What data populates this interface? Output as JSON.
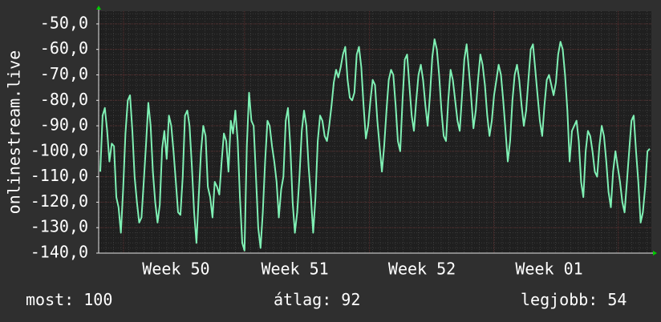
{
  "chart_data": {
    "type": "line",
    "ylabel": "onlinestream.live",
    "ylim": [
      -140,
      -45
    ],
    "y_ticks": [
      "-50,0",
      "-60,0",
      "-70,0",
      "-80,0",
      "-90,0",
      "-100,0",
      "-110,0",
      "-120,0",
      "-130,0",
      "-140,0"
    ],
    "y_tick_values": [
      -50,
      -60,
      -70,
      -80,
      -90,
      -100,
      -110,
      -120,
      -130,
      -140
    ],
    "x_ticks": [
      {
        "label": "Week 50",
        "at": 0.14
      },
      {
        "label": "Week 51",
        "at": 0.355
      },
      {
        "label": "Week 52",
        "at": 0.585
      },
      {
        "label": "Week 01",
        "at": 0.815
      }
    ],
    "grid": true,
    "series_color": "#7ff0b4",
    "series": [
      {
        "values": [
          -108,
          -86,
          -83,
          -92,
          -104,
          -97,
          -98,
          -118,
          -122,
          -132,
          -115,
          -93,
          -80,
          -78,
          -92,
          -110,
          -120,
          -128,
          -126,
          -112,
          -97,
          -81,
          -90,
          -108,
          -120,
          -128,
          -121,
          -99,
          -92,
          -103,
          -86,
          -90,
          -100,
          -112,
          -124,
          -125,
          -110,
          -86,
          -84,
          -90,
          -106,
          -124,
          -136,
          -118,
          -100,
          -90,
          -94,
          -114,
          -118,
          -126,
          -112,
          -114,
          -117,
          -104,
          -93,
          -96,
          -108,
          -88,
          -93,
          -84,
          -96,
          -118,
          -136,
          -139,
          -98,
          -77,
          -88,
          -90,
          -110,
          -130,
          -138,
          -124,
          -104,
          -88,
          -90,
          -98,
          -104,
          -112,
          -126,
          -115,
          -110,
          -88,
          -83,
          -98,
          -120,
          -132,
          -124,
          -110,
          -92,
          -84,
          -90,
          -106,
          -118,
          -132,
          -118,
          -96,
          -86,
          -88,
          -94,
          -96,
          -90,
          -82,
          -73,
          -68,
          -71,
          -67,
          -62,
          -59,
          -72,
          -79,
          -80,
          -77,
          -62,
          -59,
          -67,
          -82,
          -95,
          -90,
          -80,
          -72,
          -74,
          -88,
          -98,
          -108,
          -98,
          -84,
          -72,
          -68,
          -70,
          -82,
          -96,
          -100,
          -80,
          -64,
          -62,
          -74,
          -86,
          -92,
          -80,
          -70,
          -66,
          -72,
          -82,
          -90,
          -78,
          -63,
          -56,
          -60,
          -70,
          -84,
          -94,
          -96,
          -80,
          -68,
          -72,
          -80,
          -88,
          -92,
          -78,
          -64,
          -58,
          -68,
          -79,
          -91,
          -84,
          -72,
          -62,
          -66,
          -74,
          -86,
          -94,
          -88,
          -78,
          -72,
          -66,
          -70,
          -80,
          -92,
          -104,
          -96,
          -80,
          -70,
          -66,
          -72,
          -82,
          -90,
          -84,
          -72,
          -60,
          -58,
          -68,
          -78,
          -88,
          -94,
          -82,
          -72,
          -70,
          -74,
          -78,
          -73,
          -62,
          -57,
          -60,
          -70,
          -84,
          -104,
          -92,
          -90,
          -88,
          -96,
          -112,
          -118,
          -100,
          -92,
          -94,
          -100,
          -108,
          -110,
          -98,
          -90,
          -94,
          -104,
          -116,
          -122,
          -108,
          -100,
          -106,
          -112,
          -120,
          -124,
          -112,
          -100,
          -88,
          -86,
          -100,
          -112,
          -128,
          -124,
          -114,
          -100,
          -99
        ]
      }
    ],
    "stats": {
      "current": "most: 100",
      "average": "átlag: 92",
      "best": "legjobb: 54"
    }
  }
}
